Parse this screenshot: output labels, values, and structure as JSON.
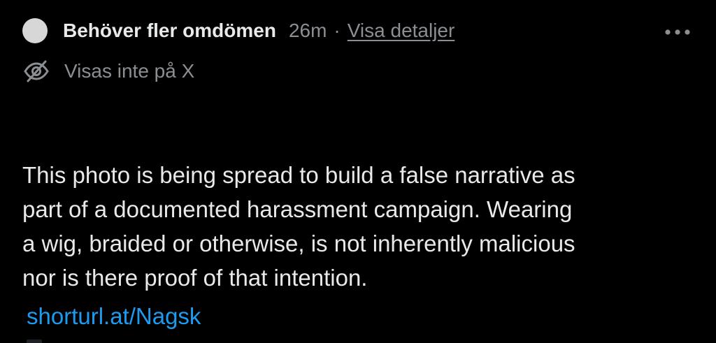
{
  "header": {
    "status": "Behöver fler omdömen",
    "time": "26m",
    "separator": "·",
    "details_link": "Visa detaljer"
  },
  "visibility": {
    "text": "Visas inte på X",
    "icon": "eye-off-icon"
  },
  "menu": {
    "icon": "more-horizontal-icon"
  },
  "note": {
    "lines": [
      "This photo is being spread to build a false narrative as",
      "part of a documented harassment campaign. Wearing",
      "a wig, braided or otherwise, is not inherently malicious",
      "nor is there proof of that intention."
    ],
    "link": "shorturl.at/Nagsk"
  },
  "colors": {
    "background": "#000000",
    "primary_text": "#e7e9ea",
    "secondary_text": "#8b8f94",
    "link": "#1d9bf0"
  }
}
